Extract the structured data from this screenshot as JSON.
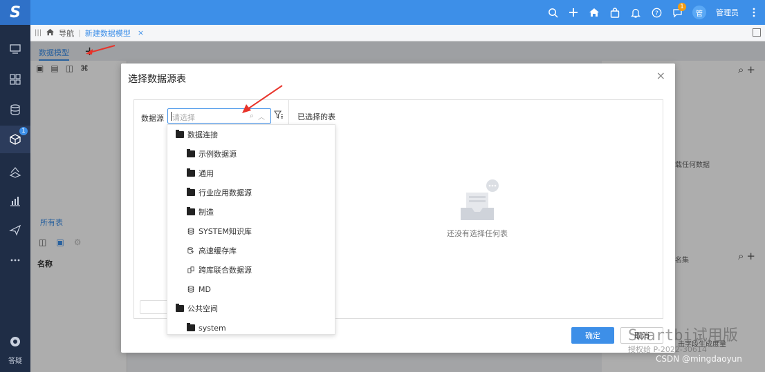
{
  "topbar": {
    "logo": "S",
    "notification_badge": "1",
    "avatar": "管",
    "username": "管理员"
  },
  "sidebar": {
    "badge": "1",
    "bottom_label": "答疑"
  },
  "breadcrumb": {
    "nav": "导航",
    "current": "新建数据模型",
    "close": "×"
  },
  "workspace": {
    "tab_label": "数据模型",
    "tab_add": "+",
    "all_tables": "所有表",
    "name_header": "名称",
    "right_text1": "载任何数据",
    "right_text2": "名集",
    "right_text3": "击字段生成度量"
  },
  "dialog": {
    "title": "选择数据源表",
    "close": "×",
    "datasource_label": "数据源",
    "datasource_placeholder": "请选择",
    "selected_tables_label": "已选择的表",
    "empty_text": "还没有选择任何表",
    "ok_label": "确定",
    "cancel_label": "取消"
  },
  "dropdown": {
    "items": [
      {
        "label": "数据连接",
        "icon": "folder-open-icon"
      },
      {
        "label": "示例数据源",
        "icon": "folder-icon"
      },
      {
        "label": "通用",
        "icon": "folder-icon"
      },
      {
        "label": "行业应用数据源",
        "icon": "folder-icon"
      },
      {
        "label": "制造",
        "icon": "folder-icon"
      },
      {
        "label": "SYSTEM知识库",
        "icon": "database-icon"
      },
      {
        "label": "高速缓存库",
        "icon": "cache-database-icon"
      },
      {
        "label": "跨库联合数据源",
        "icon": "federated-database-icon"
      },
      {
        "label": "MD",
        "icon": "database-icon"
      },
      {
        "label": "公共空间",
        "icon": "folder-open-icon"
      },
      {
        "label": "system",
        "icon": "folder-icon"
      }
    ]
  },
  "watermark": {
    "line1": "Smartbi试用版",
    "line2": "授权给 P-2022-30614",
    "line3": "CSDN @mingdaoyun"
  },
  "colors": {
    "primary": "#3d8fe8",
    "sidebar": "#1f2d46",
    "annotation_arrow": "#e8332a"
  }
}
